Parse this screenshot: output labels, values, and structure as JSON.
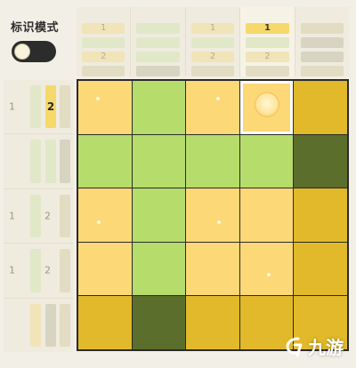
{
  "mode": {
    "label": "标识模式",
    "toggle_state": "off"
  },
  "top_clues": [
    {
      "numbers": [
        "1",
        "",
        "2",
        ""
      ]
    },
    {
      "numbers": [
        "",
        "",
        "",
        ""
      ]
    },
    {
      "numbers": [
        "1",
        "",
        "2",
        ""
      ]
    },
    {
      "numbers": [
        "1",
        "",
        "2",
        ""
      ],
      "active_number": "1"
    },
    {
      "numbers": [
        "",
        "",
        "",
        ""
      ]
    }
  ],
  "left_clues": [
    {
      "numbers": [
        "1",
        "2"
      ],
      "active_number": "2"
    },
    {
      "numbers": [
        "",
        ""
      ]
    },
    {
      "numbers": [
        "1",
        "2"
      ]
    },
    {
      "numbers": [
        "1",
        "2"
      ]
    },
    {
      "numbers": [
        "",
        ""
      ]
    }
  ],
  "board": {
    "rows": 5,
    "cols": 5,
    "cells": [
      [
        "yellow",
        "green",
        "yellow",
        "yellow",
        "gold"
      ],
      [
        "green",
        "green",
        "green",
        "green",
        "dark"
      ],
      [
        "yellow",
        "green",
        "yellow",
        "yellow",
        "gold"
      ],
      [
        "yellow",
        "green",
        "yellow",
        "yellow",
        "gold"
      ],
      [
        "gold",
        "dark",
        "gold",
        "gold",
        "gold"
      ]
    ],
    "selected_cell": {
      "row": 0,
      "col": 3
    }
  },
  "colors": {
    "yellow": "#fdd877",
    "green": "#b6dc6b",
    "gold": "#e1b92a",
    "dark": "#5b6e2b",
    "highlight": "#f7d86a"
  },
  "watermark": {
    "text": "九游",
    "icon": "jiuyou-logo-icon"
  }
}
